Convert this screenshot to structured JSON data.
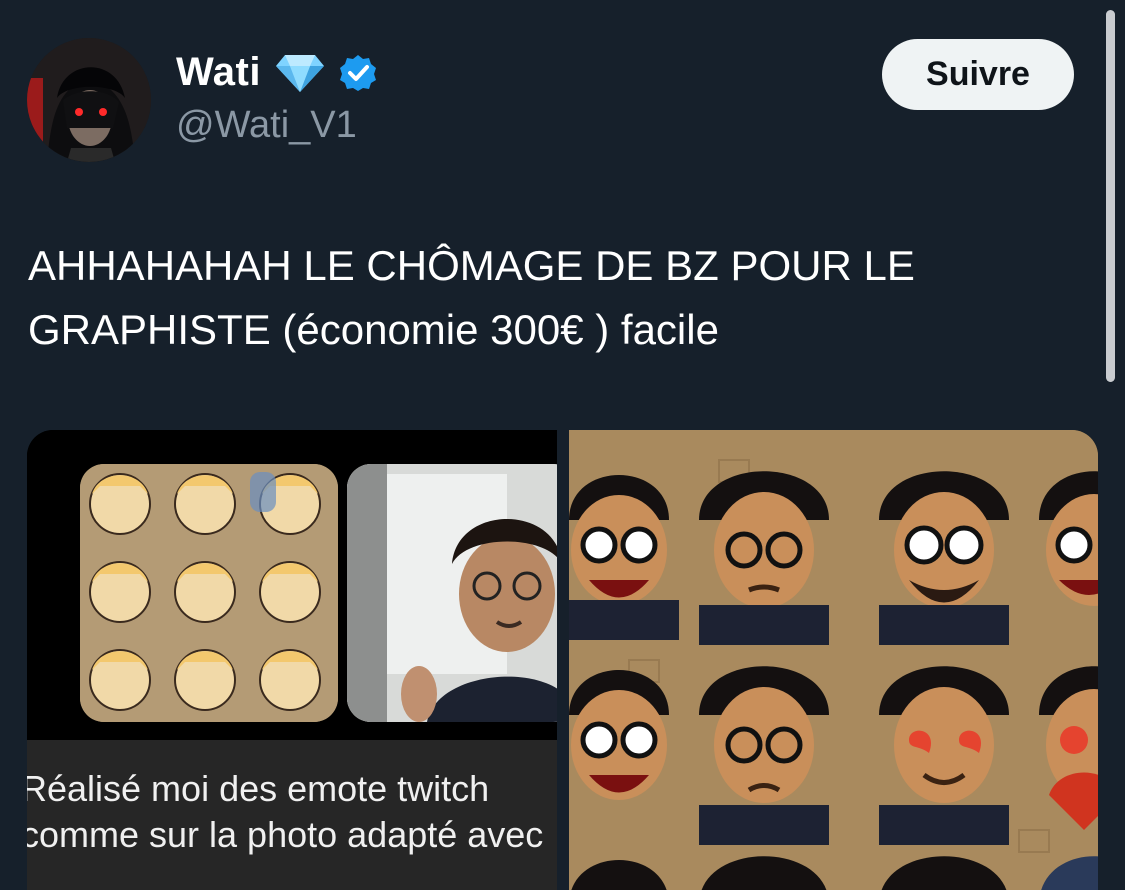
{
  "user": {
    "name": "Wati",
    "handle": "@Wati_V1",
    "badge_emoji": "💎"
  },
  "follow_button": {
    "label": "Suivre"
  },
  "tweet": {
    "line1": "AHHAHAHAH LE CHÔMAGE DE BZ POUR LE",
    "line2": "GRAPHISTE (économie 300€ ) facile"
  },
  "media": {
    "caption_line1": "Réalisé moi des emote twitch",
    "caption_line2": "comme sur la photo adapté avec"
  },
  "colors": {
    "background": "#16202b",
    "verified": "#1d9bf0",
    "follow_bg": "#eff3f4"
  },
  "icons": [
    "gem-icon",
    "verified-badge-icon"
  ]
}
